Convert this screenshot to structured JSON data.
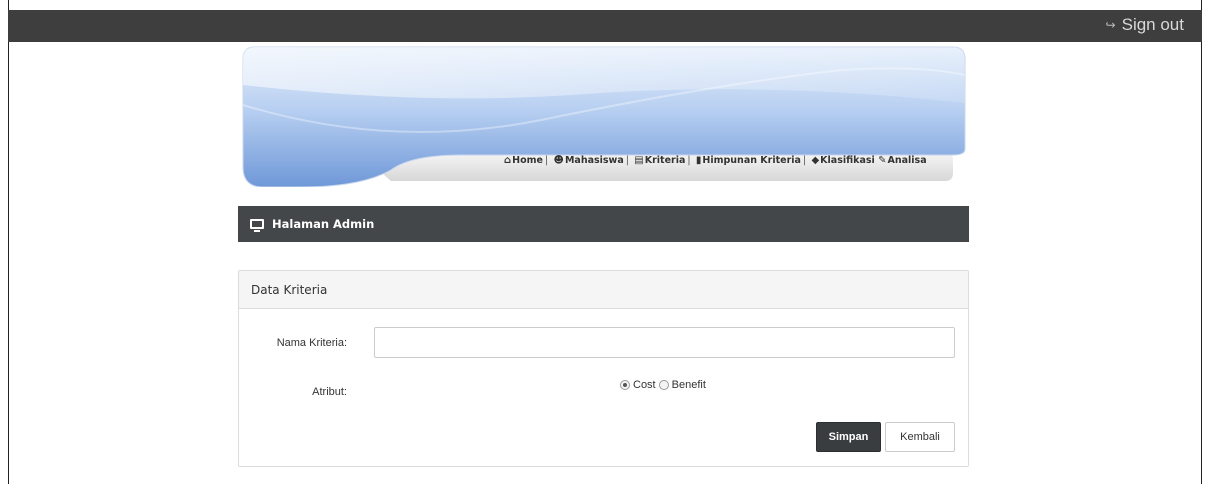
{
  "topbar": {
    "signout_icon": "sign-out-icon",
    "signout_label": "Sign out"
  },
  "nav": {
    "items": [
      {
        "icon": "home-icon",
        "label": "Home"
      },
      {
        "icon": "users-icon",
        "label": "Mahasiswa"
      },
      {
        "icon": "bar-chart-icon",
        "label": "Kriteria"
      },
      {
        "icon": "bookmark-icon",
        "label": "Himpunan Kriteria"
      },
      {
        "icon": "tag-icon",
        "label": "Klasifikasi"
      },
      {
        "icon": "pencil-icon",
        "label": "Analisa"
      }
    ]
  },
  "admin_bar": {
    "icon": "monitor-icon",
    "title": "Halaman Admin"
  },
  "panel": {
    "title": "Data Kriteria",
    "nama_label": "Nama Kriteria:",
    "nama_value": "",
    "atribut_label": "Atribut:",
    "options": [
      "Cost",
      "Benefit"
    ],
    "selected": "Cost",
    "save_label": "Simpan",
    "back_label": "Kembali"
  },
  "colors": {
    "topbar": "#3e3e3e",
    "admin_bar": "#43474a",
    "banner_blue": "#7aa3de",
    "primary_button": "#3a3d40"
  }
}
